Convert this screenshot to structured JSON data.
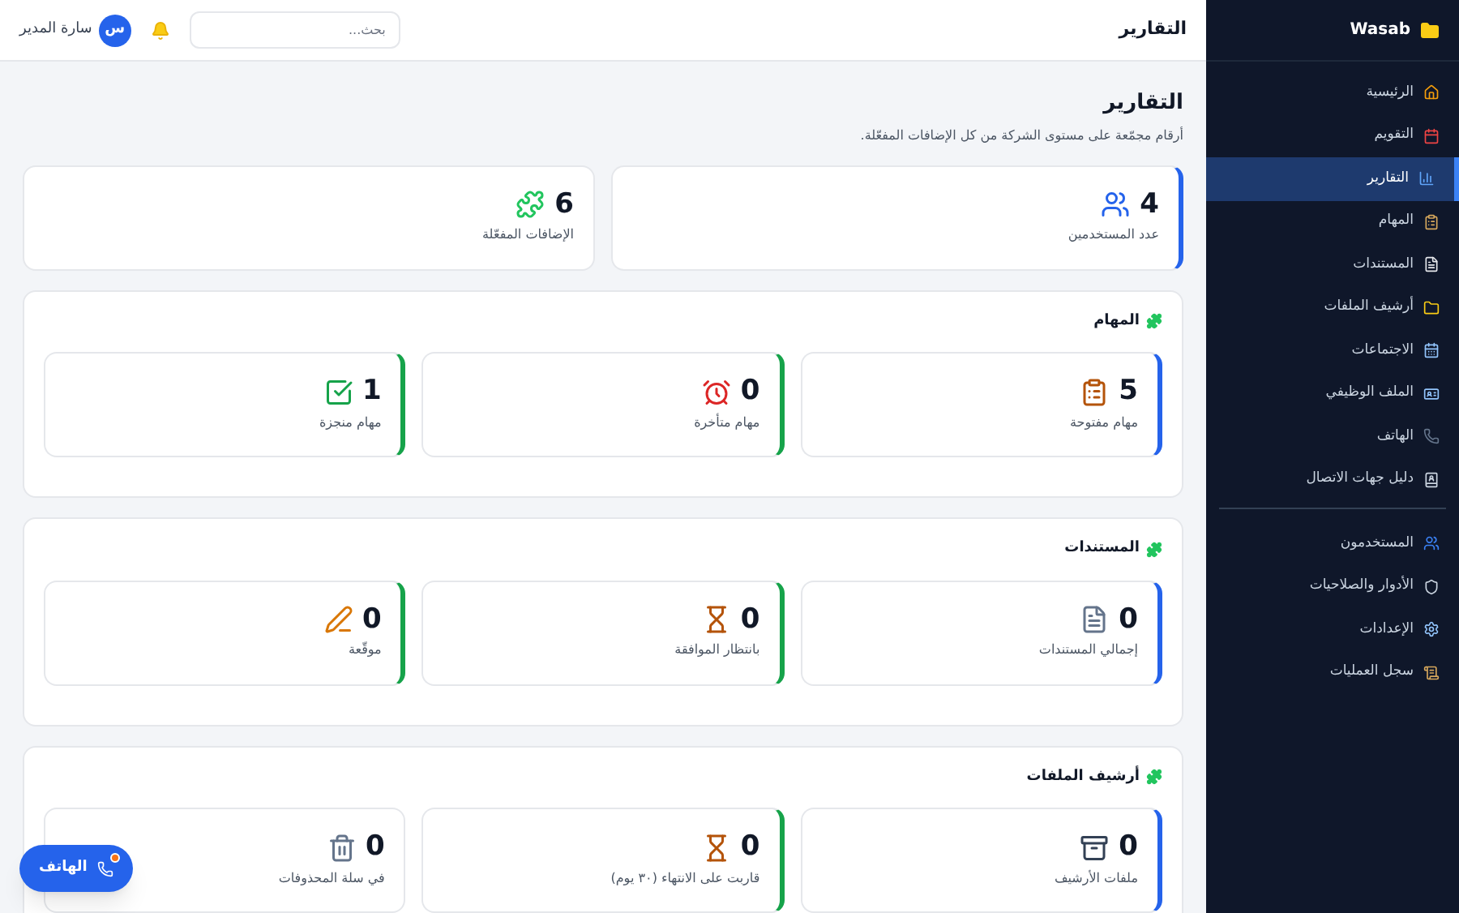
{
  "sidebar": {
    "brand": "Wasab",
    "groups": [
      [
        {
          "label": "الرئيسية",
          "selected": false
        },
        {
          "label": "التقويم",
          "selected": false
        },
        {
          "label": "التقارير",
          "selected": true
        },
        {
          "label": "المهام",
          "selected": false
        },
        {
          "label": "المستندات",
          "selected": false
        },
        {
          "label": "أرشيف الملفات",
          "selected": false
        },
        {
          "label": "الاجتماعات",
          "selected": false
        },
        {
          "label": "الملف الوظيفي",
          "selected": false
        },
        {
          "label": "الهاتف",
          "selected": false
        },
        {
          "label": "دليل جهات الاتصال",
          "selected": false
        }
      ],
      [
        {
          "label": "المستخدمون",
          "selected": false
        },
        {
          "label": "الأدوار والصلاحيات",
          "selected": false
        },
        {
          "label": "الإعدادات",
          "selected": false
        },
        {
          "label": "سجل العمليات",
          "selected": false
        }
      ]
    ]
  },
  "header": {
    "title": "التقارير",
    "search": {
      "placeholder": "بحث..."
    },
    "user": {
      "initial": "س",
      "name": "سارة المدير"
    }
  },
  "page": {
    "title": "التقارير",
    "subtitle": "أرقام مجمّعة على مستوى الشركة من كل الإضافات المفعّلة."
  },
  "summary": [
    {
      "value": "4",
      "label": "عدد المستخدمين",
      "color": "#2563eb"
    },
    {
      "value": "6",
      "label": "الإضافات المفعّلة"
    }
  ],
  "sections": [
    {
      "title": "المهام",
      "cards": [
        {
          "value": "5",
          "label": "مهام مفتوحة",
          "color": "#2563eb"
        },
        {
          "value": "0",
          "label": "مهام متأخرة",
          "color": "#16a34a"
        },
        {
          "value": "1",
          "label": "مهام منجزة",
          "color": "#16a34a"
        }
      ]
    },
    {
      "title": "المستندات",
      "cards": [
        {
          "value": "0",
          "label": "إجمالي المستندات",
          "color": "#2563eb"
        },
        {
          "value": "0",
          "label": "بانتظار الموافقة",
          "color": "#16a34a"
        },
        {
          "value": "0",
          "label": "موقّعة",
          "color": "#16a34a"
        }
      ]
    },
    {
      "title": "أرشيف الملفات",
      "cards": [
        {
          "value": "0",
          "label": "ملفات الأرشيف",
          "color": "#2563eb"
        },
        {
          "value": "0",
          "label": "قاربت على الانتهاء (٣٠ يوم)",
          "color": "#16a34a"
        },
        {
          "value": "0",
          "label": "في سلة المحذوفات"
        }
      ]
    }
  ],
  "phone_button": {
    "label": "الهاتف"
  }
}
